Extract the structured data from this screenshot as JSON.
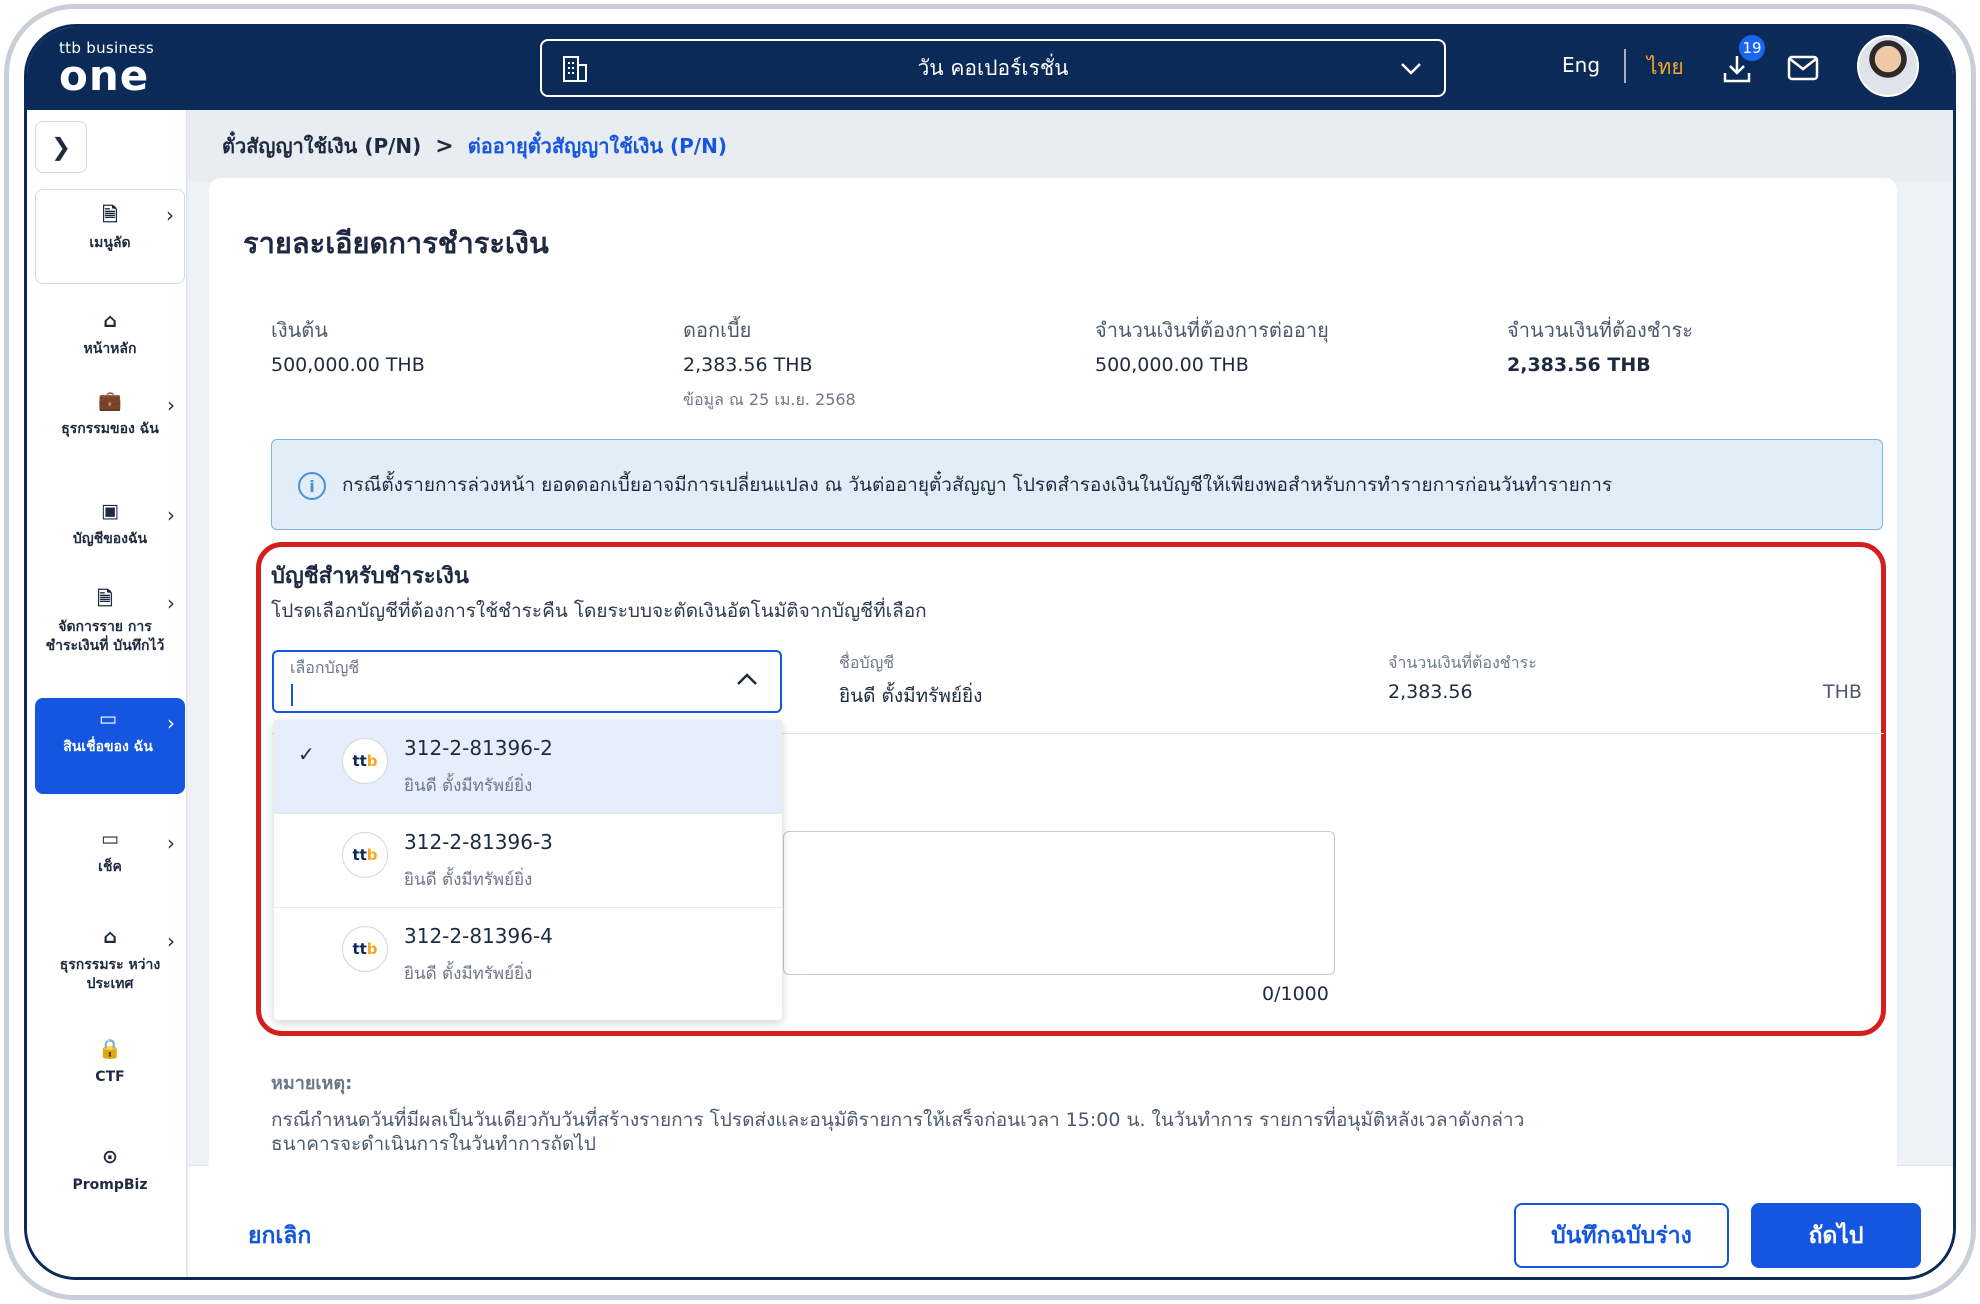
{
  "header": {
    "logo_small": "ttb business",
    "logo_big": "one",
    "company": "วัน คอเปอร์เรชั่น",
    "lang_eng": "Eng",
    "lang_thai": "ไทย",
    "download_count": "19",
    "accent": "#1556e0",
    "navy": "#0b2a57"
  },
  "sidebar": {
    "items": [
      {
        "label": "เมนูลัด",
        "icon": "shortcut-icon"
      },
      {
        "label": "หน้าหลัก",
        "icon": "home-icon"
      },
      {
        "label": "ธุรกรรมของ ฉัน",
        "icon": "briefcase-icon"
      },
      {
        "label": "บัญชีของฉัน",
        "icon": "wallet-icon"
      },
      {
        "label": "จัดการราย การชำระเงินที่ บันทึกไว้",
        "icon": "saved-doc-icon"
      },
      {
        "label": "สินเชื่อของ ฉัน",
        "icon": "credit-card-icon"
      },
      {
        "label": "เช็ค",
        "icon": "cheque-icon"
      },
      {
        "label": "ธุรกรรมระ หว่างประเทศ",
        "icon": "global-bank-icon"
      },
      {
        "label": "CTF",
        "icon": "lock-icon"
      },
      {
        "label": "PrompBiz",
        "icon": "prompbiz-icon"
      }
    ]
  },
  "breadcrumb": {
    "item1": "ตั๋วสัญญาใช้เงิน (P/N)",
    "separator": ">",
    "item2": "ต่ออายุตั๋วสัญญาใช้เงิน (P/N)"
  },
  "page": {
    "title": "รายละเอียดการชำระเงิน",
    "summary": {
      "principal_label": "เงินต้น",
      "principal_value": "500,000.00 THB",
      "interest_label": "ดอกเบี้ย",
      "interest_value": "2,383.56 THB",
      "interest_note": "ข้อมูล ณ 25 เม.ย. 2568",
      "renew_label": "จำนวนเงินที่ต้องการต่ออายุ",
      "renew_value": "500,000.00 THB",
      "pay_label": "จำนวนเงินที่ต้องชำระ",
      "pay_value": "2,383.56 THB"
    },
    "info": "กรณีตั้งรายการล่วงหน้า ยอดดอกเบี้ยอาจมีการเปลี่ยนแปลง ณ วันต่ออายุตั๋วสัญญา โปรดสำรองเงินในบัญชีให้เพียงพอสำหรับการทำรายการก่อนวันทำรายการ",
    "account_section": {
      "title": "บัญชีสำหรับชำระเงิน",
      "subtitle": "โปรดเลือกบัญชีที่ต้องการใช้ชำระคืน โดยระบบจะตัดเงินอัตโนมัติจากบัญชีที่เลือก",
      "select_label": "เลือกบัญชี",
      "account_name_label": "ชื่อบัญชี",
      "account_name_value": "ยินดี ตั้งมีทรัพย์ยิ่ง",
      "amount_label": "จำนวนเงินที่ต้องชำระ",
      "amount_value": "2,383.56",
      "currency": "THB",
      "counter": "0/1000",
      "options": [
        {
          "number": "312-2-81396-2",
          "name": "ยินดี ตั้งมีทรัพย์ยิ่ง",
          "selected": true
        },
        {
          "number": "312-2-81396-3",
          "name": "ยินดี ตั้งมีทรัพย์ยิ่ง",
          "selected": false
        },
        {
          "number": "312-2-81396-4",
          "name": "ยินดี ตั้งมีทรัพย์ยิ่ง",
          "selected": false
        }
      ],
      "bank_logo_text_a": "tt",
      "bank_logo_text_b": "b"
    },
    "remark_title": "หมายเหตุ:",
    "remark_line1": "กรณีกำหนดวันที่มีผลเป็นวันเดียวกับวันที่สร้างรายการ โปรดส่งและอนุมัติรายการให้เสร็จก่อนเวลา 15:00 น. ในวันทำการ รายการที่อนุมัติหลังเวลาดังกล่าว",
    "remark_line2": "ธนาคารจะดำเนินการในวันทำการถัดไป"
  },
  "footer": {
    "cancel": "ยกเลิก",
    "save_draft": "บันทึกฉบับร่าง",
    "next": "ถัดไป"
  }
}
